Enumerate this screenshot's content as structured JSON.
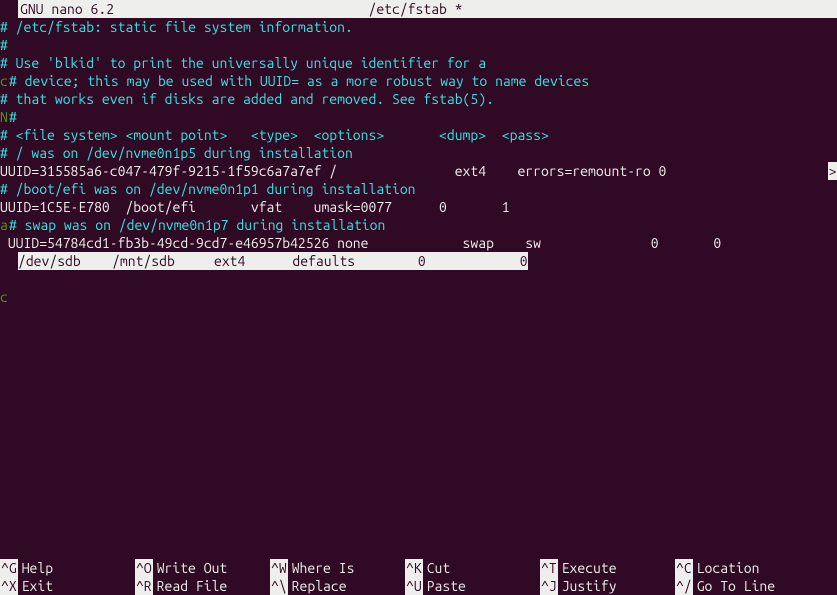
{
  "titlebar": {
    "app": "GNU nano 6.2",
    "filename": "/etc/fstab *"
  },
  "content": {
    "lines": [
      {
        "text": "# /etc/fstab: static file system information.",
        "type": "comment"
      },
      {
        "text": "#",
        "type": "comment"
      },
      {
        "text": "# Use 'blkid' to print the universally unique identifier for a",
        "type": "comment"
      },
      {
        "text": "# device; this may be used with UUID= as a more robust way to name devices",
        "type": "comment",
        "edge": "c"
      },
      {
        "text": "# that works even if disks are added and removed. See fstab(5).",
        "type": "comment"
      },
      {
        "text": "#",
        "type": "comment",
        "edge": "N"
      },
      {
        "text": "# <file system> <mount point>   <type>  <options>       <dump>  <pass>",
        "type": "comment"
      },
      {
        "text": "# / was on /dev/nvme0n1p5 during installation",
        "type": "comment"
      },
      {
        "text": "UUID=315585a6-c047-479f-9215-1f59c6a7a7ef /               ext4    errors=remount-ro 0 ",
        "type": "normal",
        "overflow": ">"
      },
      {
        "text": "# /boot/efi was on /dev/nvme0n1p1 during installation",
        "type": "comment"
      },
      {
        "text": "UUID=1C5E-E780  /boot/efi       vfat    umask=0077      0       1",
        "type": "normal"
      },
      {
        "text": "# swap was on /dev/nvme0n1p7 during installation",
        "type": "comment",
        "edge": "a"
      },
      {
        "text": " UUID=54784cd1-fb3b-49cd-9cd7-e46957b42526 none            swap    sw              0       0",
        "type": "normal"
      },
      {
        "text": "/dev/sdb    /mnt/sdb     ext4      defaults        0            0",
        "type": "highlight"
      }
    ]
  },
  "shortcuts": {
    "row1": [
      {
        "key": "^G",
        "desc": "Help"
      },
      {
        "key": "^O",
        "desc": "Write Out"
      },
      {
        "key": "^W",
        "desc": "Where Is"
      },
      {
        "key": "^K",
        "desc": "Cut"
      },
      {
        "key": "^T",
        "desc": "Execute"
      },
      {
        "key": "^C",
        "desc": "Location"
      }
    ],
    "row2": [
      {
        "key": "^X",
        "desc": "Exit"
      },
      {
        "key": "^R",
        "desc": "Read File"
      },
      {
        "key": "^\\",
        "desc": "Replace"
      },
      {
        "key": "^U",
        "desc": "Paste"
      },
      {
        "key": "^J",
        "desc": "Justify"
      },
      {
        "key": "^/",
        "desc": "Go To Line"
      }
    ]
  },
  "edge_column_char": "c"
}
